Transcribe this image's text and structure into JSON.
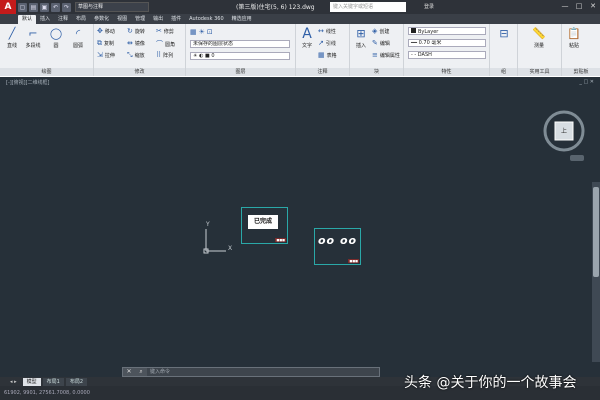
{
  "titlebar": {
    "logo": "A",
    "workspace": "草图与注释",
    "document_title": "(第三版)住宅(5, 6) 123.dwg",
    "search_placeholder": "键入关键字或短语",
    "login": "登录",
    "controls": [
      "—",
      "□",
      "✕"
    ]
  },
  "tabs": [
    "默认",
    "插入",
    "注释",
    "布局",
    "参数化",
    "视图",
    "管理",
    "输出",
    "插件",
    "Autodesk 360",
    "精选应用"
  ],
  "ribbon": {
    "draw": {
      "title": "绘图",
      "line": "直线",
      "polyline": "多段线",
      "circle": "圆",
      "arc": "圆弧"
    },
    "modify": {
      "title": "修改",
      "move": "移动",
      "rotate": "旋转",
      "trim": "修剪",
      "copy": "复制",
      "mirror": "镜像",
      "fillet": "圆角",
      "stretch": "拉伸",
      "scale": "缩放",
      "array": "阵列"
    },
    "layers": {
      "title": "图层",
      "state": "未保存的图层状态",
      "current": "0"
    },
    "annotation": {
      "title": "注释",
      "text": "文字",
      "dimension": "线性",
      "leader": "引线",
      "table": "表格"
    },
    "block": {
      "title": "块",
      "insert": "插入",
      "create": "创建",
      "edit": "编辑",
      "attrs": "编辑属性"
    },
    "properties": {
      "title": "特性",
      "color": "ByLayer",
      "lineweight": "0.70 毫米",
      "linetype": "DASH"
    },
    "groups": {
      "title": "组"
    },
    "utilities": {
      "title": "实用工具",
      "measure": "测量"
    },
    "clipboard": {
      "title": "剪贴板",
      "paste": "粘贴"
    }
  },
  "viewport": {
    "label": "[-][俯视][二维线框]",
    "controls": "_ □ ✕",
    "compass": "上",
    "axis_x": "X",
    "axis_y": "Y"
  },
  "blocks": [
    {
      "text": "已完成",
      "tag": "■■■"
    },
    {
      "text": "oo oo",
      "tag": "■■■"
    }
  ],
  "command": {
    "placeholder": "键入命令",
    "close": "✕"
  },
  "layout_tabs": [
    "模型",
    "布局1",
    "布局2"
  ],
  "status_text": "61902, 9901, 27561.7008, 0.0000",
  "watermark": "头条 @关于你的一个故事会"
}
